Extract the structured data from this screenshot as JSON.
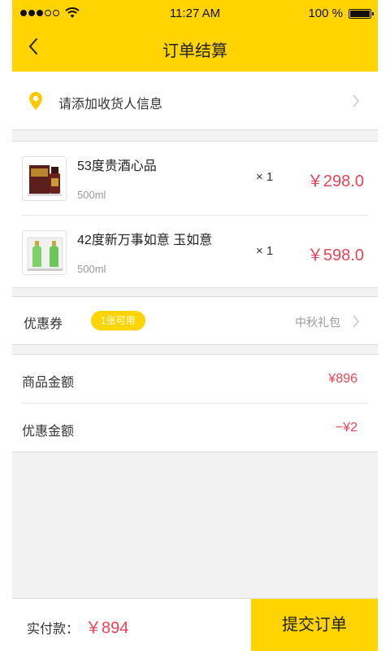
{
  "status_bar": {
    "time": "11:27 AM",
    "battery": "100 %"
  },
  "header": {
    "title": "订单结算",
    "back_icon": "chevron-left-icon"
  },
  "address": {
    "placeholder_text": "请添加收货人信息",
    "icon": "location-pin-icon"
  },
  "products": [
    {
      "name": "53度贵酒心品",
      "spec": "500ml",
      "quantity": "× 1",
      "price": "￥298.0"
    },
    {
      "name": "42度新万事如意 玉如意",
      "spec": "500ml",
      "quantity": "× 1",
      "price": "￥598.0"
    }
  ],
  "coupon": {
    "label": "优惠券",
    "badge": "1张可用",
    "value": "中秋礼包"
  },
  "amounts": [
    {
      "label": "商品金额",
      "value": "¥896"
    },
    {
      "label": "优惠金额",
      "value": "−¥2"
    }
  ],
  "footer": {
    "pay_label": "实付款：",
    "pay_value": "￥894",
    "submit_label": "提交订单"
  },
  "colors": {
    "accent": "#FFD400",
    "price": "#E84357",
    "background": "#F2F2F2"
  }
}
